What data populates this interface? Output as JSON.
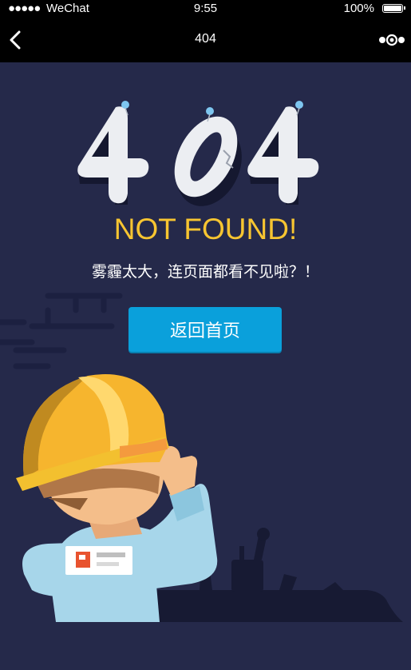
{
  "status_bar": {
    "signal": "●●●●●",
    "carrier": "WeChat",
    "time": "9:55",
    "battery_percent": "100%",
    "battery_icon": "battery-full-icon"
  },
  "nav": {
    "back_icon": "chevron-left-icon",
    "title": "404",
    "more_icon": "more-dots-icon"
  },
  "error": {
    "code": "404",
    "headline": "NOT FOUND!",
    "message": "雾霾太大，连页面都看不见啦？！"
  },
  "actions": {
    "home_button_label": "返回首页"
  },
  "colors": {
    "background": "#25294a",
    "accent_yellow": "#f7c531",
    "button_blue": "#0aa0db",
    "bar_black": "#000000"
  }
}
